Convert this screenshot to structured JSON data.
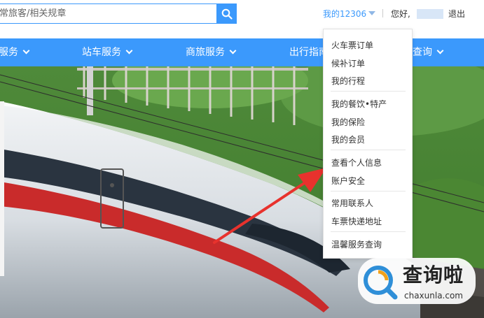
{
  "header": {
    "search": {
      "value": "常旅客/相关规章"
    },
    "my12306": "我的12306",
    "greeting": "您好,",
    "logout": "退出"
  },
  "nav": {
    "items": [
      {
        "label": "服务"
      },
      {
        "label": "站车服务"
      },
      {
        "label": "商旅服务"
      },
      {
        "label": "出行指南"
      },
      {
        "label": "查询"
      }
    ]
  },
  "dropdown": {
    "items": [
      "火车票订单",
      "候补订单",
      "我的行程",
      "我的餐饮•特产",
      "我的保险",
      "我的会员",
      "查看个人信息",
      "账户安全",
      "常用联系人",
      "车票快递地址",
      "温馨服务查询"
    ]
  },
  "watermark": {
    "text": "查询啦",
    "url": "chaxunla.com"
  },
  "colors": {
    "accent": "#3b99fc",
    "annotation_arrow": "#e8322d"
  }
}
